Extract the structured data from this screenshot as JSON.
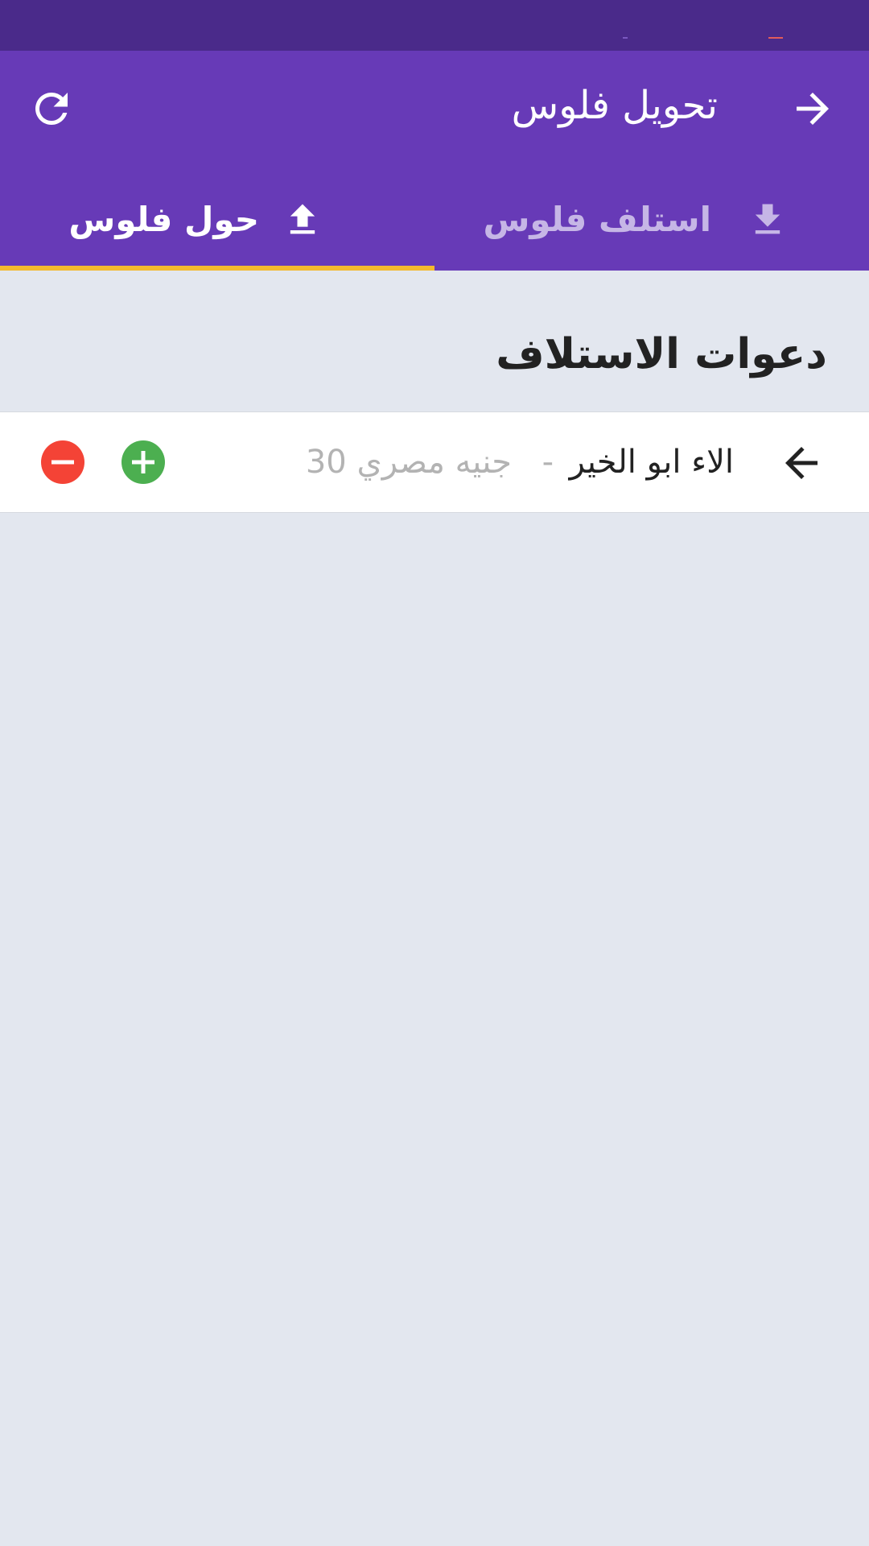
{
  "colors": {
    "status_bar": "#4a2a8a",
    "app_bar": "#673ab7",
    "tab_indicator": "#f4b92c",
    "background": "#e3e7ef",
    "accept": "#4caf50",
    "reject": "#f44336"
  },
  "app_bar": {
    "title": "تحويل فلوس",
    "back_icon": "arrow-forward-icon",
    "refresh_icon": "refresh-icon"
  },
  "tabs": [
    {
      "label": "استلف فلوس",
      "icon": "download-icon",
      "selected": false
    },
    {
      "label": "حول فلوس",
      "icon": "upload-icon",
      "selected": true
    }
  ],
  "section": {
    "title": "دعوات الاستلاف"
  },
  "requests": [
    {
      "name": "الاء ابو الخير",
      "separator": "-",
      "amount": "30 جنيه مصري",
      "accept_icon": "add-circle-icon",
      "reject_icon": "remove-circle-icon"
    }
  ]
}
